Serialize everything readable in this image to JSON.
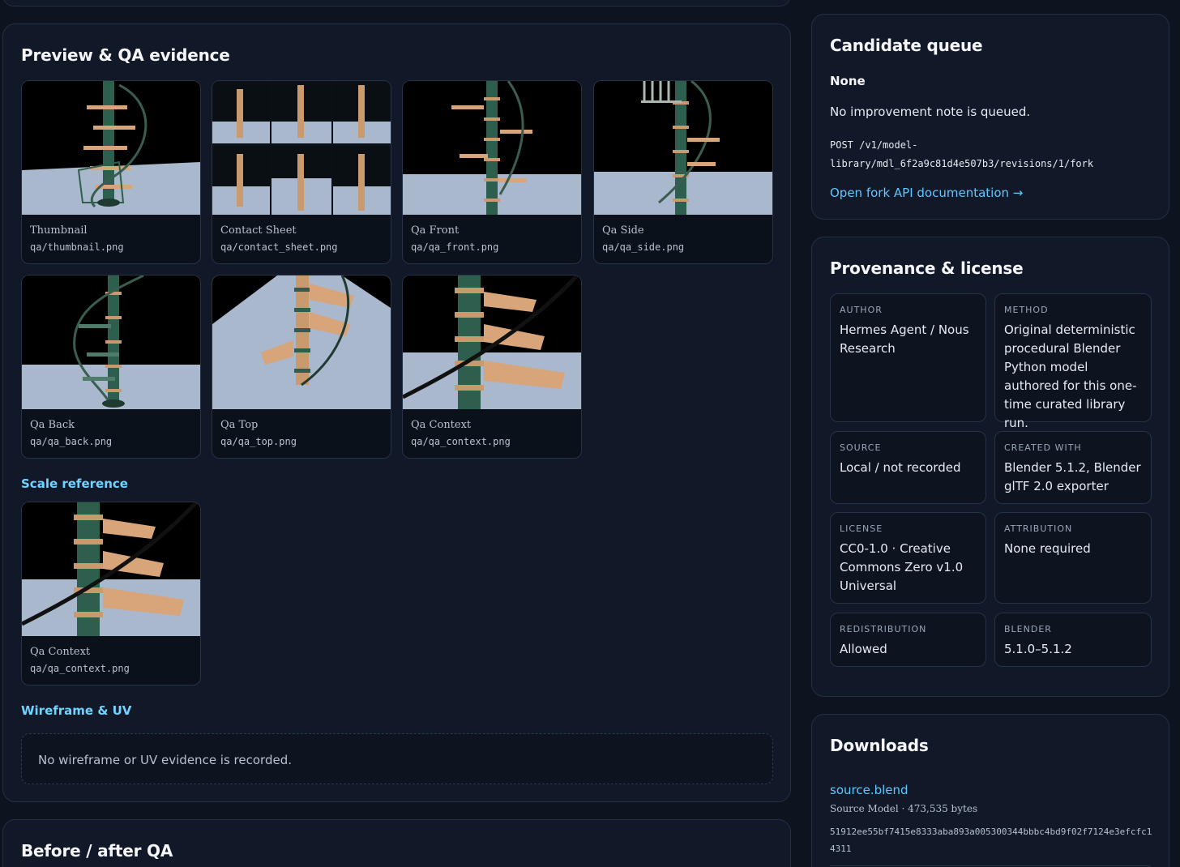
{
  "preview": {
    "title": "Preview & QA evidence",
    "cards": [
      {
        "label": "Thumbnail",
        "path": "qa/thumbnail.png"
      },
      {
        "label": "Contact Sheet",
        "path": "qa/contact_sheet.png"
      },
      {
        "label": "Qa Front",
        "path": "qa/qa_front.png"
      },
      {
        "label": "Qa Side",
        "path": "qa/qa_side.png"
      },
      {
        "label": "Qa Back",
        "path": "qa/qa_back.png"
      },
      {
        "label": "Qa Top",
        "path": "qa/qa_top.png"
      },
      {
        "label": "Qa Context",
        "path": "qa/qa_context.png"
      }
    ],
    "scale_heading": "Scale reference",
    "scale_card": {
      "label": "Qa Context",
      "path": "qa/qa_context.png"
    },
    "wire_heading": "Wireframe & UV",
    "wire_empty": "No wireframe or UV evidence is recorded."
  },
  "before_after": {
    "title": "Before / after QA"
  },
  "queue": {
    "title": "Candidate queue",
    "status": "None",
    "note": "No improvement note is queued.",
    "endpoint_line1": "POST /v1/model-",
    "endpoint_line2": "library/mdl_6f2a9c81d4e507b3/revisions/1/fork",
    "link": "Open fork API documentation →"
  },
  "provenance": {
    "title": "Provenance & license",
    "fields": [
      {
        "key": "AUTHOR",
        "value": "Hermes Agent / Nous Research"
      },
      {
        "key": "METHOD",
        "value": "Original deterministic procedural Blender Python model authored for this one-time curated library run."
      },
      {
        "key": "SOURCE",
        "value": "Local / not recorded"
      },
      {
        "key": "CREATED WITH",
        "value": "Blender 5.1.2, Blender glTF 2.0 exporter"
      },
      {
        "key": "LICENSE",
        "value": "CC0-1.0 · Creative Commons Zero v1.0 Universal"
      },
      {
        "key": "ATTRIBUTION",
        "value": "None required"
      },
      {
        "key": "REDISTRIBUTION",
        "value": "Allowed"
      },
      {
        "key": "BLENDER",
        "value": "5.1.0–5.1.2"
      }
    ]
  },
  "downloads": {
    "title": "Downloads",
    "file": "source.blend",
    "meta": "Source Model · 473,535 bytes",
    "hash": "51912ee55bf7415e8333aba893a005300344bbbc4bd9f02f7124e3efcfc14311"
  }
}
